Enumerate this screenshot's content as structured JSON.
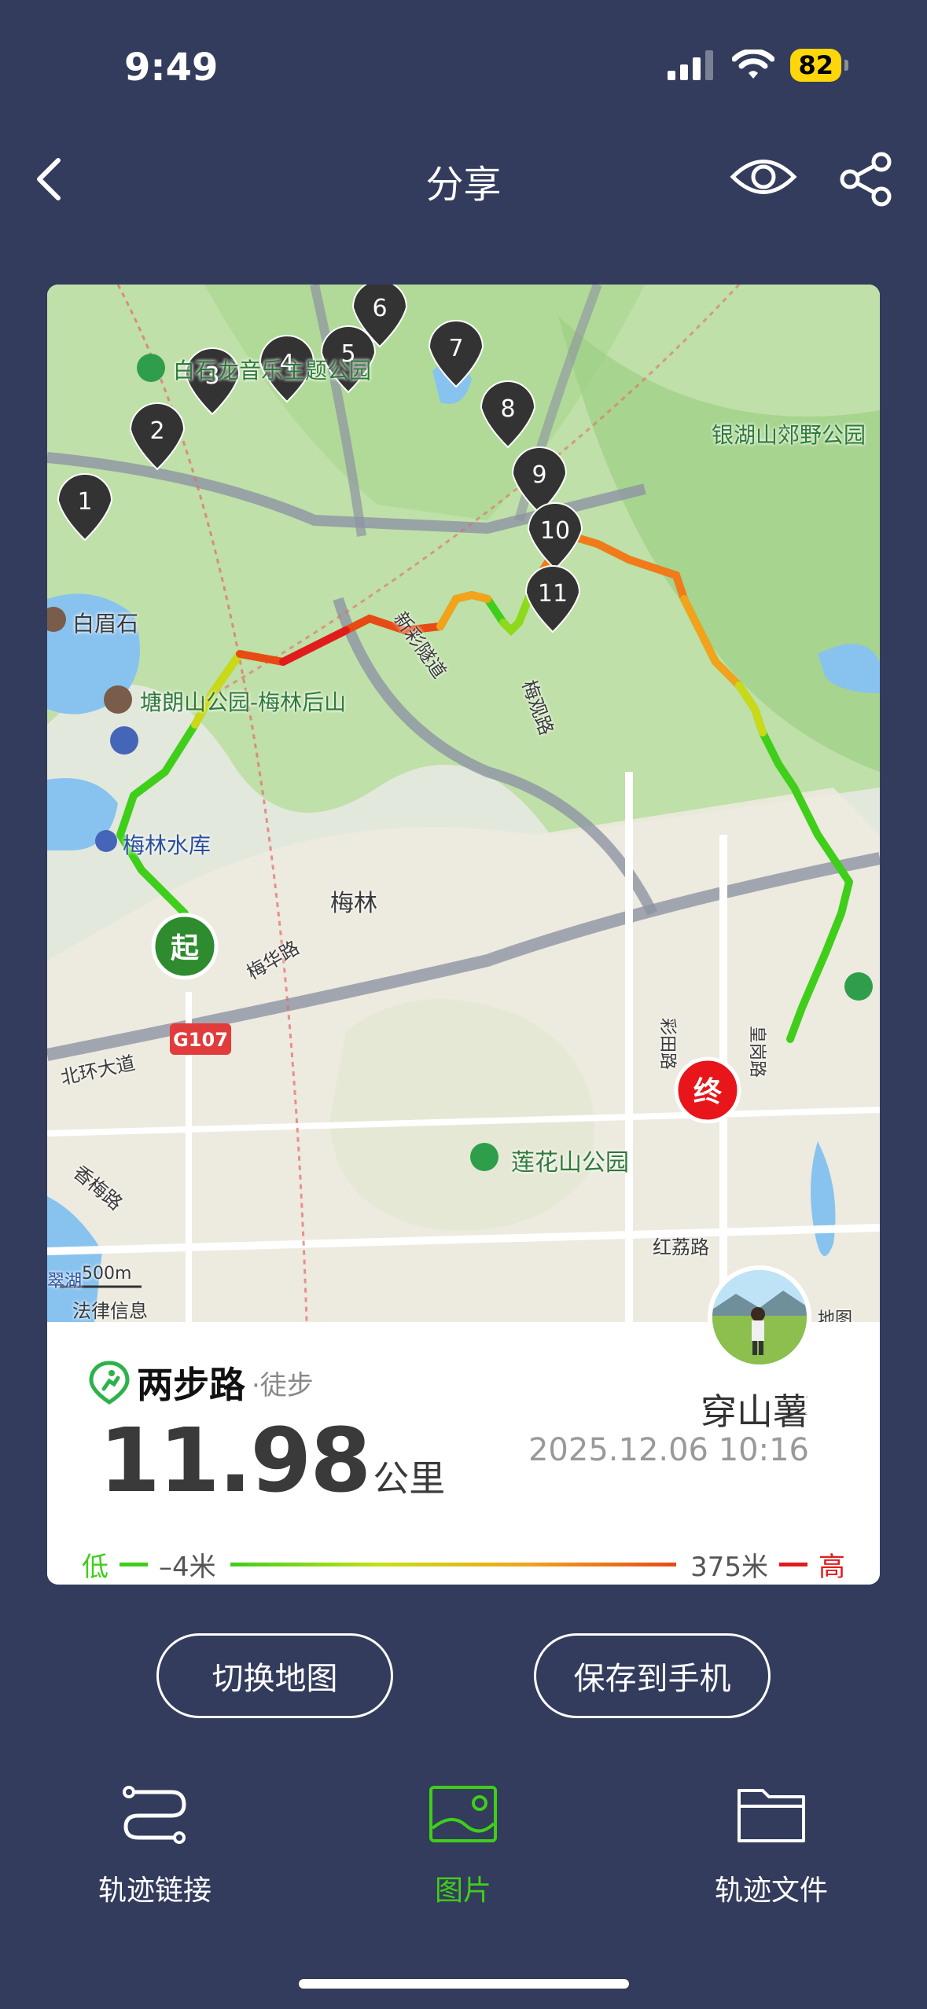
{
  "status_bar": {
    "time": "9:49",
    "battery": "82"
  },
  "nav": {
    "title": "分享",
    "back_icon": "chevron-left-icon",
    "eye_icon": "eye-icon",
    "share_icon": "share-icon"
  },
  "map": {
    "labels": {
      "park_baishilong": "白石龙音乐主题公园",
      "park_yinhushan": "银湖山郊野公园",
      "baimeishi": "白眉石",
      "meilin_back_park": "塘朗山公园-梅林后山",
      "meilin_reservoir": "梅林水库",
      "xincai_tunnel": "新彩隧道",
      "meiguan_road": "梅观路",
      "meilin": "梅林",
      "meihua_road": "梅华路",
      "g107": "G107",
      "beihuan": "北环大道",
      "xiangmei_road": "香梅路",
      "caitian_road": "彩田路",
      "huanggang_road": "皇岗路",
      "lianhuashan_park": "莲花山公园",
      "honglili_road": "红荔路",
      "scale": "500m",
      "legal": "法律信息",
      "lake_edge": "翠湖",
      "ditu_edge": "地图"
    },
    "start_marker": "起",
    "end_marker": "终",
    "waypoints": [
      "1",
      "2",
      "3",
      "4",
      "5",
      "6",
      "7",
      "8",
      "9",
      "10",
      "11"
    ]
  },
  "info": {
    "brand_name": "两步路",
    "brand_type": "·徒步",
    "distance_value": "11.98",
    "distance_unit": "公里",
    "user_name": "穿山薯",
    "user_emoji": "🐭",
    "date": "2025.12.06 10:16",
    "legend": {
      "low": "低",
      "low_value": "–4米",
      "high_value": "375米",
      "high": "高"
    }
  },
  "buttons": {
    "switch_map": "切换地图",
    "save_phone": "保存到手机"
  },
  "tabs": [
    {
      "label": "轨迹链接",
      "icon": "route-link-icon",
      "active": false
    },
    {
      "label": "图片",
      "icon": "image-icon",
      "active": true
    },
    {
      "label": "轨迹文件",
      "icon": "folder-icon",
      "active": false
    }
  ],
  "colors": {
    "background": "#333c5c",
    "accent": "#3fce1a",
    "track_low": "#3fce1a",
    "track_high": "#e21c1c",
    "end_marker": "#e8151b",
    "start_marker": "#2e8b2e"
  }
}
